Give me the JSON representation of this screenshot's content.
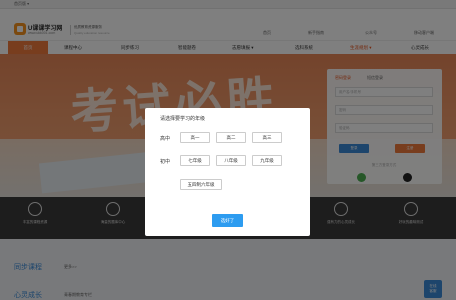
{
  "topbar": {
    "location": "首页版 ▾"
  },
  "logo": {
    "title": "U课课学习网",
    "url": "www.ukk001.com",
    "slogan": "优质教育资源服务",
    "slogan_sub": "Quality education resource"
  },
  "toplinks": [
    "首页",
    "新手指南",
    "公众号",
    "移动客户端"
  ],
  "nav": {
    "items": [
      "首页",
      "课程中心",
      "同步练习",
      "智能题卷",
      "志愿填报 ▾",
      "选科系统",
      "生涯规划 ▾",
      "心灵成长"
    ]
  },
  "banner": {
    "headline": "考试必胜"
  },
  "login": {
    "tabs": [
      "密码登录",
      "短信登录"
    ],
    "fields": [
      "用户名/手机号",
      "密码",
      "验证码"
    ],
    "buttons": [
      "登录",
      "注册"
    ],
    "third_party": "第三方登录方式"
  },
  "features": [
    "丰富的课程资源",
    "海量的题库中心",
    "",
    "",
    "",
    "强有力的心灵成长",
    "好玩的趣味测试"
  ],
  "sections": {
    "sync_course": "同步课程",
    "more": "更多>>",
    "growth": "心灵成长",
    "growth_sub": "青春期教育专栏"
  },
  "float_button": [
    "在线",
    "客服"
  ],
  "dialog": {
    "title": "请选择要学习的年级",
    "rows": [
      {
        "label": "高中",
        "grades": [
          "高一",
          "高二",
          "高三"
        ]
      },
      {
        "label": "初中",
        "grades": [
          "七年级",
          "八年级",
          "九年级"
        ]
      },
      {
        "label": "",
        "grades": [
          "五四制六年级"
        ]
      }
    ],
    "confirm": "选好了"
  },
  "colors": {
    "accent_orange": "#f07a3c",
    "primary_blue": "#2d9cf0",
    "section_blue": "#3a8bd9",
    "overlay": "rgba(0,0,0,0.5)"
  }
}
